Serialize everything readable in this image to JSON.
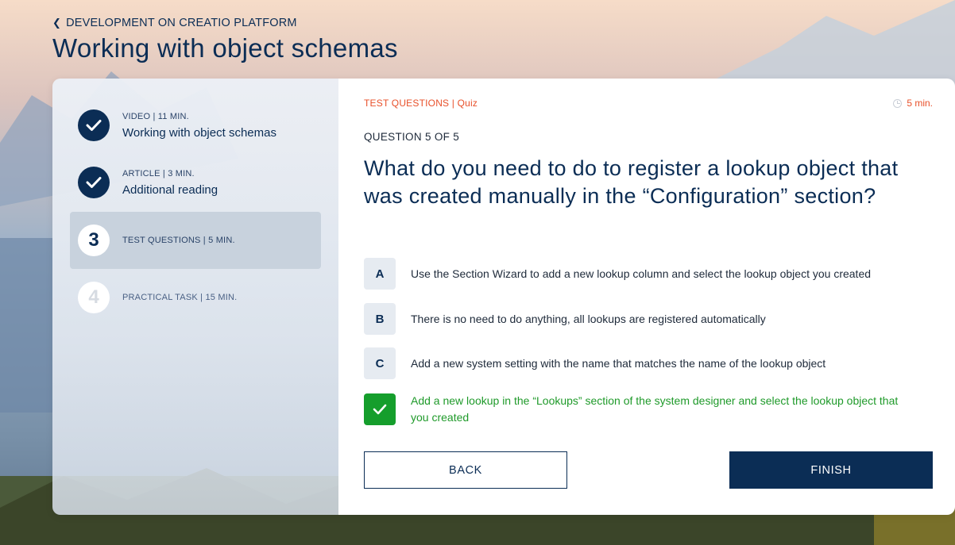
{
  "header": {
    "breadcrumb": "DEVELOPMENT ON CREATIO PLATFORM",
    "title": "Working with object schemas"
  },
  "sidebar": {
    "steps": [
      {
        "number": "",
        "status": "done",
        "meta": "VIDEO | 11 MIN.",
        "name": "Working with object schemas"
      },
      {
        "number": "",
        "status": "done",
        "meta": "ARTICLE | 3 MIN.",
        "name": "Additional reading"
      },
      {
        "number": "3",
        "status": "current",
        "meta": "TEST QUESTIONS | 5 MIN.",
        "name": ""
      },
      {
        "number": "4",
        "status": "pending",
        "meta": "PRACTICAL TASK | 15 MIN.",
        "name": ""
      }
    ]
  },
  "quiz": {
    "section_tag": "TEST QUESTIONS | Quiz",
    "timer": "5 min.",
    "counter": "QUESTION 5 OF 5",
    "question": "What do you need to do to register a lookup object that was created manually in the “Configuration” section?",
    "options": [
      {
        "letter": "A",
        "text": "Use the Section Wizard to add a new lookup column and select the lookup object you created",
        "selected": false
      },
      {
        "letter": "B",
        "text": "There is no need to do anything, all lookups are registered automatically",
        "selected": false
      },
      {
        "letter": "C",
        "text": "Add a new system setting with the name that matches the name of the lookup object",
        "selected": false
      },
      {
        "letter": "",
        "text": "Add a new lookup in the “Lookups” section of the system designer and select the lookup object that you created",
        "selected": true
      }
    ]
  },
  "buttons": {
    "back": "BACK",
    "finish": "FINISH"
  },
  "colors": {
    "primary": "#0b2d55",
    "accent": "#e8502a",
    "correct": "#159e2c"
  }
}
